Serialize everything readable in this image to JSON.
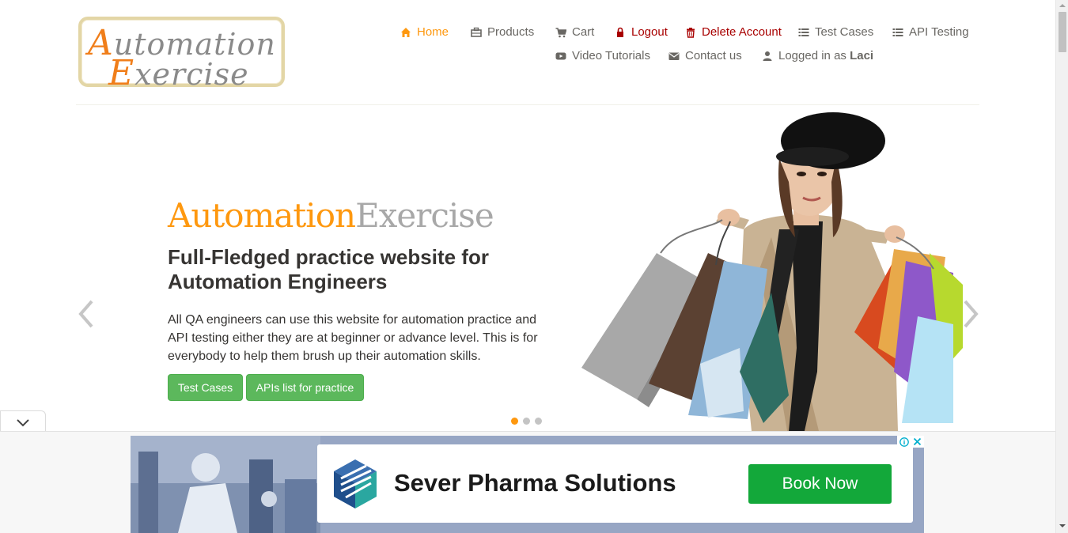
{
  "header": {
    "logo": {
      "line1_cap": "A",
      "line1_rest": "utomation",
      "line2_cap": "E",
      "line2_rest": "xercise"
    },
    "nav": [
      {
        "label": "Home",
        "icon": "home-icon"
      },
      {
        "label": "Products",
        "icon": "products-icon"
      },
      {
        "label": "Cart",
        "icon": "cart-icon"
      },
      {
        "label": "Logout",
        "icon": "lock-icon"
      },
      {
        "label": "Delete Account",
        "icon": "trash-icon"
      },
      {
        "label": "Test Cases",
        "icon": "list-icon"
      },
      {
        "label": "API Testing",
        "icon": "list-icon"
      },
      {
        "label": "Video Tutorials",
        "icon": "youtube-icon"
      },
      {
        "label": "Contact us",
        "icon": "envelope-icon"
      },
      {
        "label_prefix": "Logged in as",
        "username": "Laci",
        "icon": "user-icon"
      }
    ]
  },
  "hero": {
    "brand_part1": "Automation",
    "brand_part2": "Exercise",
    "heading": "Full-Fledged practice website for Automation Engineers",
    "text": "All QA engineers can use this website for automation practice and API testing either they are at beginner or advance level. This is for everybody to help them brush up their automation skills.",
    "button_test_cases": "Test Cases",
    "button_apis": "APIs list for practice",
    "active_slide": 1,
    "slide_count": 3
  },
  "ad": {
    "advertiser": "Sever Pharma Solutions",
    "cta": "Book Now",
    "info_icon": "info-icon",
    "close_icon": "close-icon"
  },
  "colors": {
    "accent_orange": "#FE980F",
    "nav_text": "#696763",
    "nav_red": "#A80000",
    "button_green": "#5CB85C",
    "ad_cta_green": "#13A83A"
  }
}
